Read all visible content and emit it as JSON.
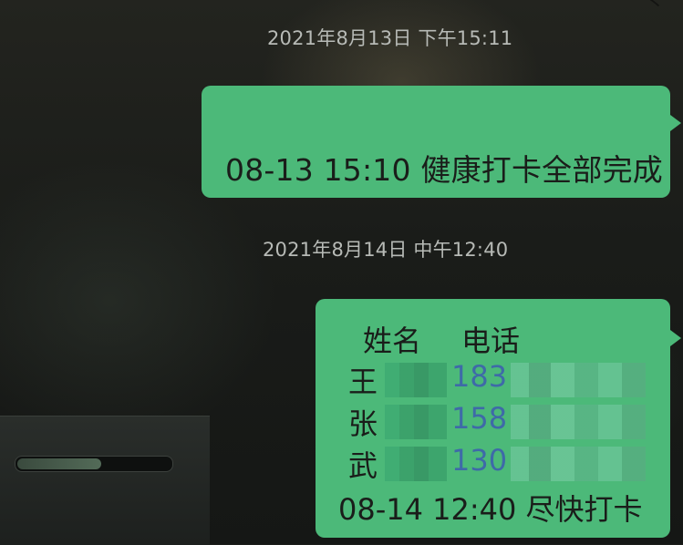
{
  "messages": [
    {
      "timestamp": "2021年8月13日 下午15:11",
      "text": "08-13 15:10 健康打卡全部完成"
    },
    {
      "timestamp": "2021年8月14日 中午12:40",
      "table": {
        "headers": [
          "姓名",
          "电话"
        ],
        "rows": [
          {
            "name": "王",
            "phone": "183"
          },
          {
            "name": "张",
            "phone": "158"
          },
          {
            "name": "武",
            "phone": "130"
          }
        ]
      },
      "footer": "08-14 12:40 尽快打卡"
    }
  ],
  "colors": {
    "bubble": "#4cb979",
    "phone_text": "#3e6aa8",
    "timestamp_text": "#b7bab6"
  },
  "background_widget": {
    "progress": 0.55
  }
}
